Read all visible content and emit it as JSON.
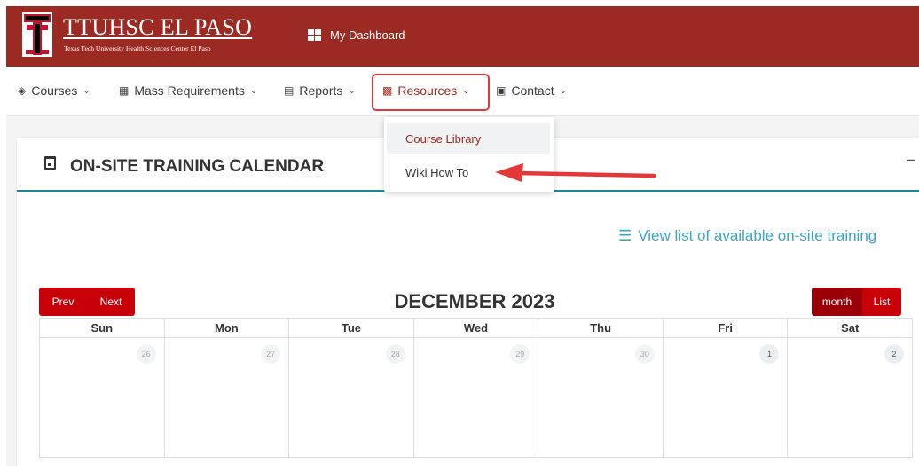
{
  "header": {
    "logo_title": "TTUHSC EL PASO",
    "logo_subtitle": "Texas Tech University Health Sciences Center El Paso",
    "dashboard_label": "My Dashboard",
    "brand_color": "#9b2a22"
  },
  "nav": {
    "items": [
      {
        "label": "Courses",
        "icon": "book-icon"
      },
      {
        "label": "Mass Requirements",
        "icon": "clipboard-icon"
      },
      {
        "label": "Reports",
        "icon": "monitor-icon"
      },
      {
        "label": "Resources",
        "icon": "books-icon",
        "active": true
      },
      {
        "label": "Contact",
        "icon": "contact-icon"
      }
    ]
  },
  "dropdown": {
    "items": [
      {
        "label": "Course Library"
      },
      {
        "label": "Wiki How To"
      }
    ]
  },
  "card": {
    "title": "ON-SITE TRAINING CALENDAR",
    "collapse_symbol": "–",
    "view_list_label": "View list of available on-site training"
  },
  "calendar": {
    "prev_label": "Prev",
    "next_label": "Next",
    "month_title": "DECEMBER 2023",
    "view_month_label": "month",
    "view_list_label": "List",
    "weekdays": [
      "Sun",
      "Mon",
      "Tue",
      "Wed",
      "Thu",
      "Fri",
      "Sat"
    ],
    "week1_days": [
      "26",
      "27",
      "28",
      "29",
      "30",
      "1",
      "2"
    ],
    "accent_color": "#c8000a",
    "link_color": "#3aa6c4"
  }
}
